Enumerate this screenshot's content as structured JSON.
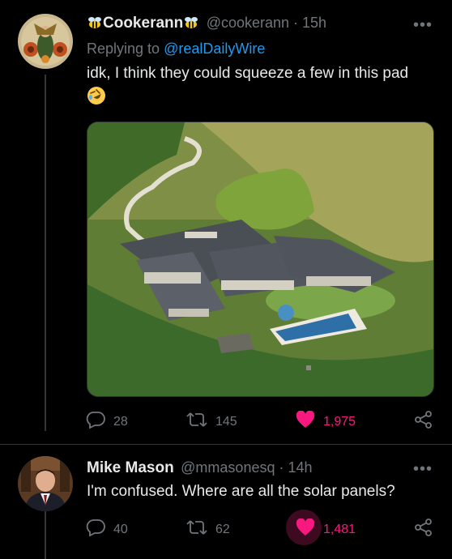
{
  "tweet1": {
    "display_name": "Cookerann",
    "handle_time": "@cookerann · 15h",
    "replying_prefix": "Replying to",
    "replying_to": "@realDailyWire",
    "text": "idk, I think they could squeeze a few in this pad",
    "emoji_icon": "rofl-emoji",
    "stats": {
      "replies": "28",
      "retweets": "145",
      "likes": "1,975"
    },
    "liked": true
  },
  "tweet2": {
    "display_name": "Mike Mason",
    "handle_time": "@mmasonesq · 14h",
    "text": "I'm confused. Where are all the solar panels?",
    "stats": {
      "replies": "40",
      "retweets": "62",
      "likes": "1,481"
    },
    "liked": true
  },
  "more_glyph": "•••",
  "colors": {
    "like": "#f91880",
    "link": "#1d9bf0",
    "muted": "#71767b",
    "bg": "#000000"
  }
}
